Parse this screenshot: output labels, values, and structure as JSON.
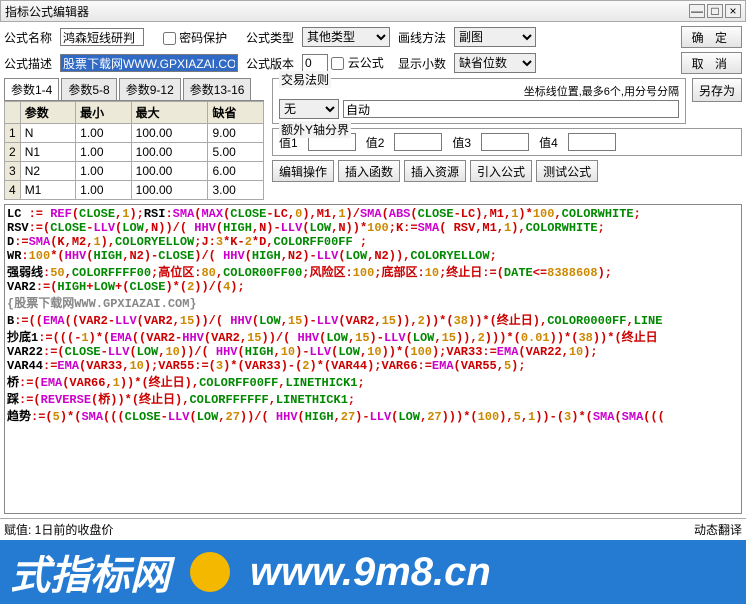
{
  "window": {
    "title": "指标公式编辑器"
  },
  "top": {
    "name_label": "公式名称",
    "name_value": "鸿森短线研判",
    "pwd_label": "密码保护",
    "type_label": "公式类型",
    "type_value": "其他类型",
    "draw_label": "画线方法",
    "draw_value": "副图",
    "desc_label": "公式描述",
    "desc_value": "股票下载网WWW.GPXIAZAI.COM",
    "ver_label": "公式版本",
    "ver_value": "0",
    "cloud_label": "云公式",
    "dec_label": "显示小数",
    "dec_value": "缺省位数",
    "ok": "确  定",
    "cancel": "取  消",
    "saveas": "另存为"
  },
  "tabs": [
    "参数1-4",
    "参数5-8",
    "参数9-12",
    "参数13-16"
  ],
  "param_head": [
    "参数",
    "最小",
    "最大",
    "缺省"
  ],
  "params": [
    {
      "n": "1",
      "a": "N",
      "b": "1.00",
      "c": "100.00",
      "d": "9.00"
    },
    {
      "n": "2",
      "a": "N1",
      "b": "1.00",
      "c": "100.00",
      "d": "5.00"
    },
    {
      "n": "3",
      "a": "N2",
      "b": "1.00",
      "c": "100.00",
      "d": "6.00"
    },
    {
      "n": "4",
      "a": "M1",
      "b": "1.00",
      "c": "100.00",
      "d": "3.00"
    }
  ],
  "trade": {
    "legend": "交易法则",
    "hint": "坐标线位置,最多6个,用分号分隔",
    "none": "无",
    "auto": "自动"
  },
  "yaxis": {
    "legend": "额外Y轴分界",
    "v1": "值1",
    "v2": "值2",
    "v3": "值3",
    "v4": "值4"
  },
  "actions": {
    "edit": "编辑操作",
    "func": "插入函数",
    "res": "插入资源",
    "imp": "引入公式",
    "test": "测试公式"
  },
  "status": {
    "left": "赋值: 1日前的收盘价",
    "right": "动态翻译"
  },
  "footer": {
    "left": "式指标网",
    "right": "www.9m8.cn"
  },
  "code_lines": [
    {
      "segs": [
        [
          "LC ",
          "black"
        ],
        [
          ":=",
          "red"
        ],
        [
          " ",
          "black"
        ],
        [
          "REF",
          "mag"
        ],
        [
          "(",
          "red"
        ],
        [
          "CLOSE",
          "green"
        ],
        [
          ",",
          "red"
        ],
        [
          "1",
          "orange"
        ],
        [
          ")",
          "red"
        ],
        [
          ";",
          "red"
        ],
        [
          "RSI",
          "black"
        ],
        [
          ":",
          "red"
        ],
        [
          "SMA",
          "mag"
        ],
        [
          "(",
          "red"
        ],
        [
          "MAX",
          "mag"
        ],
        [
          "(",
          "red"
        ],
        [
          "CLOSE",
          "green"
        ],
        [
          "-LC,",
          "red"
        ],
        [
          "0",
          "orange"
        ],
        [
          "),M1,",
          "red"
        ],
        [
          "1",
          "orange"
        ],
        [
          ")/",
          "red"
        ],
        [
          "SMA",
          "mag"
        ],
        [
          "(",
          "red"
        ],
        [
          "ABS",
          "mag"
        ],
        [
          "(",
          "red"
        ],
        [
          "CLOSE",
          "green"
        ],
        [
          "-LC),M1,",
          "red"
        ],
        [
          "1",
          "orange"
        ],
        [
          ")*",
          "red"
        ],
        [
          "100",
          "orange"
        ],
        [
          ",",
          "red"
        ],
        [
          "COLORWHITE",
          "green"
        ],
        [
          ";",
          "red"
        ]
      ]
    },
    {
      "segs": [
        [
          "RSV",
          "black"
        ],
        [
          ":=(",
          "red"
        ],
        [
          "CLOSE",
          "green"
        ],
        [
          "-",
          "red"
        ],
        [
          "LLV",
          "mag"
        ],
        [
          "(",
          "red"
        ],
        [
          "LOW",
          "green"
        ],
        [
          ",N))/( ",
          "red"
        ],
        [
          "HHV",
          "mag"
        ],
        [
          "(",
          "red"
        ],
        [
          "HIGH",
          "green"
        ],
        [
          ",N)-",
          "red"
        ],
        [
          "LLV",
          "mag"
        ],
        [
          "(",
          "red"
        ],
        [
          "LOW",
          "green"
        ],
        [
          ",N))*",
          "red"
        ],
        [
          "100",
          "orange"
        ],
        [
          ";K:=",
          "red"
        ],
        [
          "SMA",
          "mag"
        ],
        [
          "( RSV,M1,",
          "red"
        ],
        [
          "1",
          "orange"
        ],
        [
          "),",
          "red"
        ],
        [
          "COLORWHITE",
          "green"
        ],
        [
          ";",
          "red"
        ]
      ]
    },
    {
      "segs": [
        [
          "D",
          "black"
        ],
        [
          ":=",
          "red"
        ],
        [
          "SMA",
          "mag"
        ],
        [
          "(K,M2,",
          "red"
        ],
        [
          "1",
          "orange"
        ],
        [
          "),",
          "red"
        ],
        [
          "COLORYELLOW",
          "green"
        ],
        [
          ";J:",
          "red"
        ],
        [
          "3",
          "orange"
        ],
        [
          "*K-",
          "red"
        ],
        [
          "2",
          "orange"
        ],
        [
          "*D,",
          "red"
        ],
        [
          "COLORFF00FF",
          "green"
        ],
        [
          " ;",
          "red"
        ]
      ]
    },
    {
      "segs": [
        [
          "WR",
          "black"
        ],
        [
          ":",
          "red"
        ],
        [
          "100",
          "orange"
        ],
        [
          "*(",
          "red"
        ],
        [
          "HHV",
          "mag"
        ],
        [
          "(",
          "red"
        ],
        [
          "HIGH",
          "green"
        ],
        [
          ",N2)-",
          "red"
        ],
        [
          "CLOSE",
          "green"
        ],
        [
          ")/( ",
          "red"
        ],
        [
          "HHV",
          "mag"
        ],
        [
          "(",
          "red"
        ],
        [
          "HIGH",
          "green"
        ],
        [
          ",N2)-",
          "red"
        ],
        [
          "LLV",
          "mag"
        ],
        [
          "(",
          "red"
        ],
        [
          "LOW",
          "green"
        ],
        [
          ",N2)),",
          "red"
        ],
        [
          "COLORYELLOW",
          "green"
        ],
        [
          ";",
          "red"
        ]
      ]
    },
    {
      "segs": [
        [
          "强弱线",
          "black"
        ],
        [
          ":",
          "red"
        ],
        [
          "50",
          "orange"
        ],
        [
          ",",
          "red"
        ],
        [
          "COLORFFFF00",
          "green"
        ],
        [
          ";高位区:",
          "red"
        ],
        [
          "80",
          "orange"
        ],
        [
          ",",
          "red"
        ],
        [
          "COLOR00FF00",
          "green"
        ],
        [
          ";风险区:",
          "red"
        ],
        [
          "100",
          "orange"
        ],
        [
          ";底部区:",
          "red"
        ],
        [
          "10",
          "orange"
        ],
        [
          ";终止日:=(",
          "red"
        ],
        [
          "DATE",
          "green"
        ],
        [
          "<=",
          "red"
        ],
        [
          "8388608",
          "orange"
        ],
        [
          ");",
          "red"
        ]
      ]
    },
    {
      "segs": [
        [
          "VAR2",
          "black"
        ],
        [
          ":=(",
          "red"
        ],
        [
          "HIGH",
          "green"
        ],
        [
          "+",
          "red"
        ],
        [
          "LOW",
          "green"
        ],
        [
          "+(",
          "red"
        ],
        [
          "CLOSE",
          "green"
        ],
        [
          ")*(",
          "red"
        ],
        [
          "2",
          "orange"
        ],
        [
          "))/(",
          "red"
        ],
        [
          "4",
          "orange"
        ],
        [
          ");",
          "red"
        ]
      ]
    },
    {
      "segs": [
        [
          "{股票下载网WWW.GPXIAZAI.COM}",
          "gray"
        ]
      ]
    },
    {
      "segs": [
        [
          "B",
          "black"
        ],
        [
          ":=((",
          "red"
        ],
        [
          "EMA",
          "mag"
        ],
        [
          "((VAR2-",
          "red"
        ],
        [
          "LLV",
          "mag"
        ],
        [
          "(VAR2,",
          "red"
        ],
        [
          "15",
          "orange"
        ],
        [
          "))/( ",
          "red"
        ],
        [
          "HHV",
          "mag"
        ],
        [
          "(",
          "red"
        ],
        [
          "LOW",
          "green"
        ],
        [
          ",",
          "red"
        ],
        [
          "15",
          "orange"
        ],
        [
          ")-",
          "red"
        ],
        [
          "LLV",
          "mag"
        ],
        [
          "(VAR2,",
          "red"
        ],
        [
          "15",
          "orange"
        ],
        [
          ")),",
          "red"
        ],
        [
          "2",
          "orange"
        ],
        [
          "))*(",
          "red"
        ],
        [
          "38",
          "orange"
        ],
        [
          "))*(终止日),",
          "red"
        ],
        [
          "COLOR0000FF",
          "green"
        ],
        [
          ",",
          "red"
        ],
        [
          "LINE",
          "green"
        ]
      ]
    },
    {
      "segs": [
        [
          "抄底1",
          "black"
        ],
        [
          ":=(((-",
          "red"
        ],
        [
          "1",
          "orange"
        ],
        [
          ")*(",
          "red"
        ],
        [
          "EMA",
          "mag"
        ],
        [
          "((VAR2-",
          "red"
        ],
        [
          "HHV",
          "mag"
        ],
        [
          "(VAR2,",
          "red"
        ],
        [
          "15",
          "orange"
        ],
        [
          "))/( ",
          "red"
        ],
        [
          "HHV",
          "mag"
        ],
        [
          "(",
          "red"
        ],
        [
          "LOW",
          "green"
        ],
        [
          ",",
          "red"
        ],
        [
          "15",
          "orange"
        ],
        [
          ")-",
          "red"
        ],
        [
          "LLV",
          "mag"
        ],
        [
          "(",
          "red"
        ],
        [
          "LOW",
          "green"
        ],
        [
          ",",
          "red"
        ],
        [
          "15",
          "orange"
        ],
        [
          ")),",
          "red"
        ],
        [
          "2",
          "orange"
        ],
        [
          ")))*(",
          "red"
        ],
        [
          "0.01",
          "orange"
        ],
        [
          "))*(",
          "red"
        ],
        [
          "38",
          "orange"
        ],
        [
          "))*(终止日",
          "red"
        ]
      ]
    },
    {
      "segs": [
        [
          "VAR22",
          "black"
        ],
        [
          ":=(",
          "red"
        ],
        [
          "CLOSE",
          "green"
        ],
        [
          "-",
          "red"
        ],
        [
          "LLV",
          "mag"
        ],
        [
          "(",
          "red"
        ],
        [
          "LOW",
          "green"
        ],
        [
          ",",
          "red"
        ],
        [
          "10",
          "orange"
        ],
        [
          "))/( ",
          "red"
        ],
        [
          "HHV",
          "mag"
        ],
        [
          "(",
          "red"
        ],
        [
          "HIGH",
          "green"
        ],
        [
          ",",
          "red"
        ],
        [
          "10",
          "orange"
        ],
        [
          ")-",
          "red"
        ],
        [
          "LLV",
          "mag"
        ],
        [
          "(",
          "red"
        ],
        [
          "LOW",
          "green"
        ],
        [
          ",",
          "red"
        ],
        [
          "10",
          "orange"
        ],
        [
          "))*(",
          "red"
        ],
        [
          "100",
          "orange"
        ],
        [
          ");VAR33:=",
          "red"
        ],
        [
          "EMA",
          "mag"
        ],
        [
          "(VAR22,",
          "red"
        ],
        [
          "10",
          "orange"
        ],
        [
          ");",
          "red"
        ]
      ]
    },
    {
      "segs": [
        [
          "VAR44",
          "black"
        ],
        [
          ":=",
          "red"
        ],
        [
          "EMA",
          "mag"
        ],
        [
          "(VAR33,",
          "red"
        ],
        [
          "10",
          "orange"
        ],
        [
          ");VAR55:=(",
          "red"
        ],
        [
          "3",
          "orange"
        ],
        [
          ")*(VAR33)-(",
          "red"
        ],
        [
          "2",
          "orange"
        ],
        [
          ")*(VAR44);VAR66:=",
          "red"
        ],
        [
          "EMA",
          "mag"
        ],
        [
          "(VAR55,",
          "red"
        ],
        [
          "5",
          "orange"
        ],
        [
          ");",
          "red"
        ]
      ]
    },
    {
      "segs": [
        [
          "桥",
          "black"
        ],
        [
          ":=(",
          "red"
        ],
        [
          "EMA",
          "mag"
        ],
        [
          "(VAR66,",
          "red"
        ],
        [
          "1",
          "orange"
        ],
        [
          "))*(终止日),",
          "red"
        ],
        [
          "COLORFF00FF",
          "green"
        ],
        [
          ",",
          "red"
        ],
        [
          "LINETHICK1",
          "green"
        ],
        [
          ";",
          "red"
        ]
      ]
    },
    {
      "segs": [
        [
          "踩",
          "black"
        ],
        [
          ":=(",
          "red"
        ],
        [
          "REVERSE",
          "mag"
        ],
        [
          "(桥))*(终止日),",
          "red"
        ],
        [
          "COLORFFFFFF",
          "green"
        ],
        [
          ",",
          "red"
        ],
        [
          "LINETHICK1",
          "green"
        ],
        [
          ";",
          "red"
        ]
      ]
    },
    {
      "segs": [
        [
          "趋势",
          "black"
        ],
        [
          ":=(",
          "red"
        ],
        [
          "5",
          "orange"
        ],
        [
          ")*(",
          "red"
        ],
        [
          "SMA",
          "mag"
        ],
        [
          "(((",
          "red"
        ],
        [
          "CLOSE",
          "green"
        ],
        [
          "-",
          "red"
        ],
        [
          "LLV",
          "mag"
        ],
        [
          "(",
          "red"
        ],
        [
          "LOW",
          "green"
        ],
        [
          ",",
          "red"
        ],
        [
          "27",
          "orange"
        ],
        [
          "))/( ",
          "red"
        ],
        [
          "HHV",
          "mag"
        ],
        [
          "(",
          "red"
        ],
        [
          "HIGH",
          "green"
        ],
        [
          ",",
          "red"
        ],
        [
          "27",
          "orange"
        ],
        [
          ")-",
          "red"
        ],
        [
          "LLV",
          "mag"
        ],
        [
          "(",
          "red"
        ],
        [
          "LOW",
          "green"
        ],
        [
          ",",
          "red"
        ],
        [
          "27",
          "orange"
        ],
        [
          ")))*(",
          "red"
        ],
        [
          "100",
          "orange"
        ],
        [
          "),",
          "red"
        ],
        [
          "5",
          "orange"
        ],
        [
          ",",
          "red"
        ],
        [
          "1",
          "orange"
        ],
        [
          "))-(",
          "red"
        ],
        [
          "3",
          "orange"
        ],
        [
          ")*(",
          "red"
        ],
        [
          "SMA",
          "mag"
        ],
        [
          "(",
          "red"
        ],
        [
          "SMA",
          "mag"
        ],
        [
          "(((",
          "red"
        ]
      ]
    }
  ]
}
